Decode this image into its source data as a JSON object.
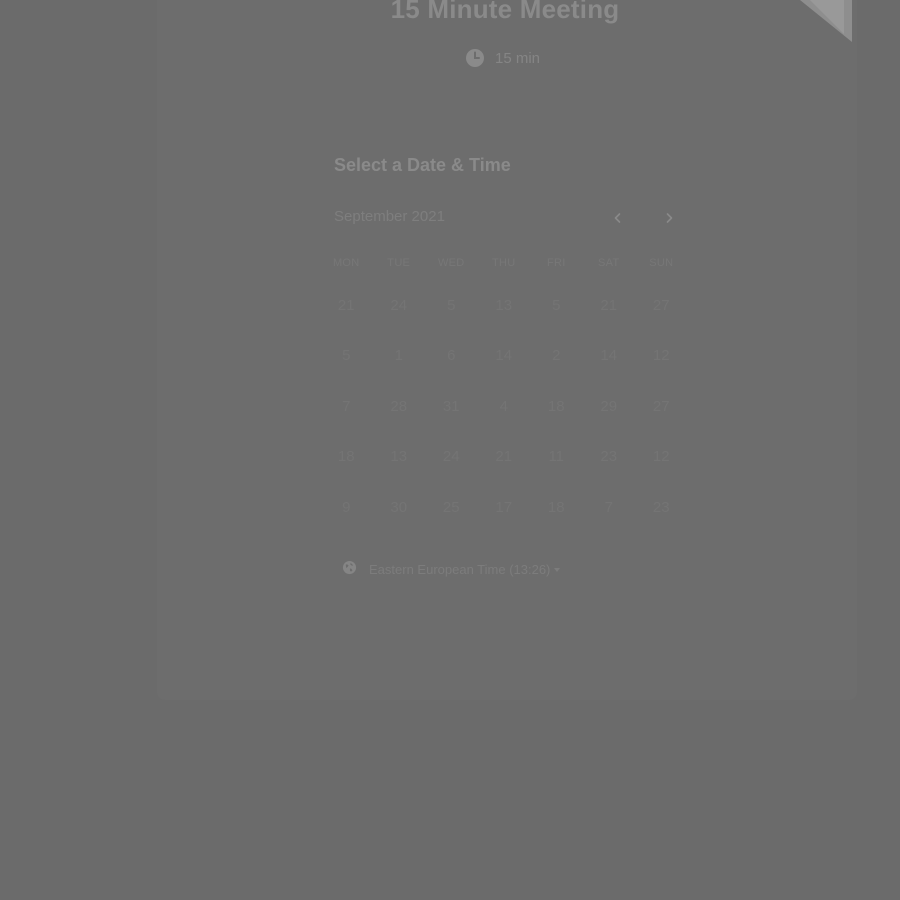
{
  "meeting": {
    "title": "15 Minute Meeting",
    "duration": "15 min"
  },
  "calendar": {
    "section_title": "Select a Date & Time",
    "month_label": "September 2021",
    "weekdays": [
      "MON",
      "TUE",
      "WED",
      "THU",
      "FRI",
      "SAT",
      "SUN"
    ],
    "weeks": [
      [
        "21",
        "24",
        "5",
        "13",
        "5",
        "21",
        "27"
      ],
      [
        "5",
        "1",
        "6",
        "14",
        "2",
        "14",
        "12"
      ],
      [
        "7",
        "28",
        "31",
        "4",
        "18",
        "29",
        "27"
      ],
      [
        "18",
        "13",
        "24",
        "21",
        "11",
        "23",
        "12"
      ],
      [
        "9",
        "30",
        "25",
        "17",
        "18",
        "7",
        "23"
      ]
    ]
  },
  "timezone": {
    "label": "Eastern European Time (13:26)"
  },
  "colors": {
    "overlay_background": "#6b6b6b",
    "title_text": "#8a8a8a",
    "icon_fill": "#8a8a8a"
  },
  "icons": {
    "duration": "clock-icon",
    "timezone": "globe-icon",
    "prev_month": "chevron-left-icon",
    "next_month": "chevron-right-icon",
    "dropdown": "caret-down-icon"
  }
}
